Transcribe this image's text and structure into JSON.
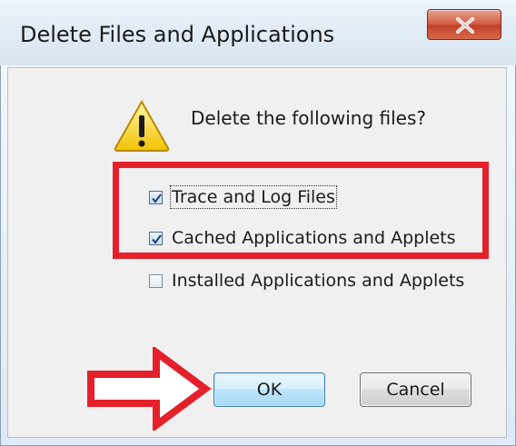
{
  "window": {
    "title": "Delete Files and Applications",
    "close_icon": "close-icon"
  },
  "dialog": {
    "icon": "warning-icon",
    "question": "Delete the following files?",
    "options": [
      {
        "label": "Trace and Log Files",
        "checked": true
      },
      {
        "label": "Cached Applications and Applets",
        "checked": true
      },
      {
        "label": "Installed Applications and Applets",
        "checked": false
      }
    ]
  },
  "buttons": {
    "ok_label": "OK",
    "cancel_label": "Cancel"
  },
  "annotations": {
    "highlight_color": "#e4212b",
    "arrow_icon": "right-arrow-icon"
  }
}
